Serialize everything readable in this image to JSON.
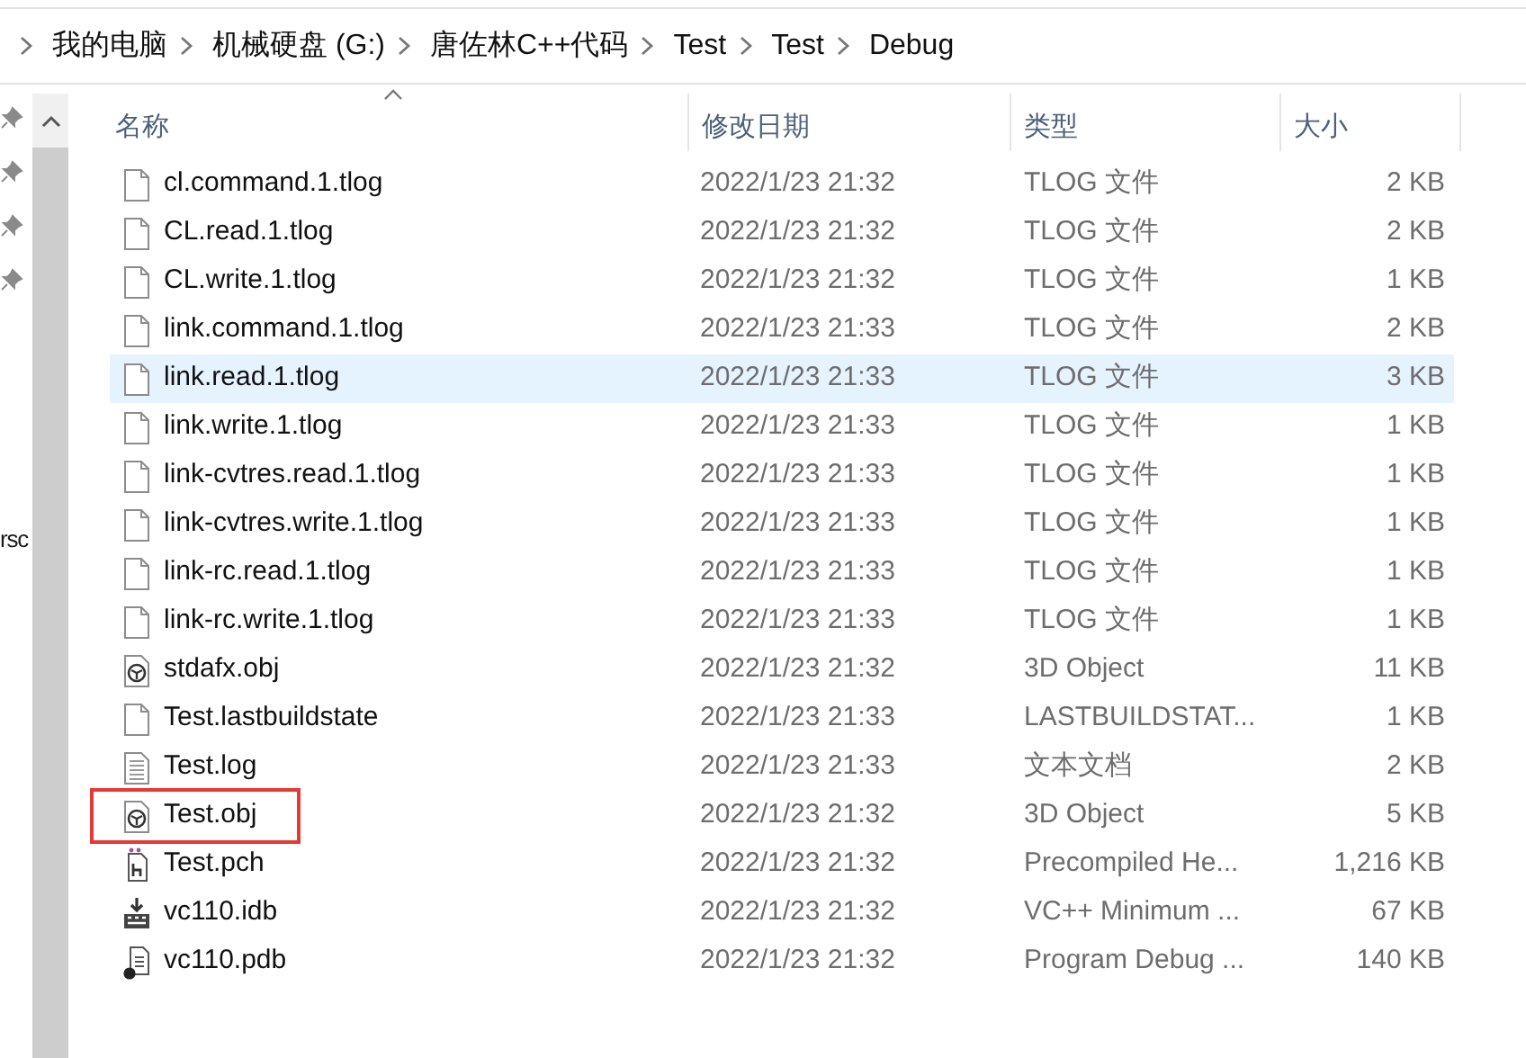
{
  "breadcrumb": [
    "我的电脑",
    "机械硬盘 (G:)",
    "唐佐林C++代码",
    "Test",
    "Test",
    "Debug"
  ],
  "sidebar": {
    "partial_label": "rsc"
  },
  "columns": [
    {
      "label": "名称",
      "sorted": true
    },
    {
      "label": "修改日期",
      "sorted": false
    },
    {
      "label": "类型",
      "sorted": false
    },
    {
      "label": "大小",
      "sorted": false
    }
  ],
  "rows": [
    {
      "name": "cl.command.1.tlog",
      "date": "2022/1/23 21:32",
      "type": "TLOG 文件",
      "size": "2 KB",
      "kind": "blank",
      "hovered": false,
      "highlighted": false
    },
    {
      "name": "CL.read.1.tlog",
      "date": "2022/1/23 21:32",
      "type": "TLOG 文件",
      "size": "2 KB",
      "kind": "blank",
      "hovered": false,
      "highlighted": false
    },
    {
      "name": "CL.write.1.tlog",
      "date": "2022/1/23 21:32",
      "type": "TLOG 文件",
      "size": "1 KB",
      "kind": "blank",
      "hovered": false,
      "highlighted": false
    },
    {
      "name": "link.command.1.tlog",
      "date": "2022/1/23 21:33",
      "type": "TLOG 文件",
      "size": "2 KB",
      "kind": "blank",
      "hovered": false,
      "highlighted": false
    },
    {
      "name": "link.read.1.tlog",
      "date": "2022/1/23 21:33",
      "type": "TLOG 文件",
      "size": "3 KB",
      "kind": "blank",
      "hovered": true,
      "highlighted": false
    },
    {
      "name": "link.write.1.tlog",
      "date": "2022/1/23 21:33",
      "type": "TLOG 文件",
      "size": "1 KB",
      "kind": "blank",
      "hovered": false,
      "highlighted": false
    },
    {
      "name": "link-cvtres.read.1.tlog",
      "date": "2022/1/23 21:33",
      "type": "TLOG 文件",
      "size": "1 KB",
      "kind": "blank",
      "hovered": false,
      "highlighted": false
    },
    {
      "name": "link-cvtres.write.1.tlog",
      "date": "2022/1/23 21:33",
      "type": "TLOG 文件",
      "size": "1 KB",
      "kind": "blank",
      "hovered": false,
      "highlighted": false
    },
    {
      "name": "link-rc.read.1.tlog",
      "date": "2022/1/23 21:33",
      "type": "TLOG 文件",
      "size": "1 KB",
      "kind": "blank",
      "hovered": false,
      "highlighted": false
    },
    {
      "name": "link-rc.write.1.tlog",
      "date": "2022/1/23 21:33",
      "type": "TLOG 文件",
      "size": "1 KB",
      "kind": "blank",
      "hovered": false,
      "highlighted": false
    },
    {
      "name": "stdafx.obj",
      "date": "2022/1/23 21:32",
      "type": "3D Object",
      "size": "11 KB",
      "kind": "object3d",
      "hovered": false,
      "highlighted": false
    },
    {
      "name": "Test.lastbuildstate",
      "date": "2022/1/23 21:33",
      "type": "LASTBUILDSTAT...",
      "size": "1 KB",
      "kind": "blank",
      "hovered": false,
      "highlighted": false
    },
    {
      "name": "Test.log",
      "date": "2022/1/23 21:33",
      "type": "文本文档",
      "size": "2 KB",
      "kind": "text",
      "hovered": false,
      "highlighted": false
    },
    {
      "name": "Test.obj",
      "date": "2022/1/23 21:32",
      "type": "3D Object",
      "size": "5 KB",
      "kind": "object3d",
      "hovered": false,
      "highlighted": true
    },
    {
      "name": "Test.pch",
      "date": "2022/1/23 21:32",
      "type": "Precompiled He...",
      "size": "1,216 KB",
      "kind": "header",
      "hovered": false,
      "highlighted": false
    },
    {
      "name": "vc110.idb",
      "date": "2022/1/23 21:32",
      "type": "VC++ Minimum ...",
      "size": "67 KB",
      "kind": "database",
      "hovered": false,
      "highlighted": false
    },
    {
      "name": "vc110.pdb",
      "date": "2022/1/23 21:32",
      "type": "Program Debug ...",
      "size": "140 KB",
      "kind": "debug",
      "hovered": false,
      "highlighted": false
    }
  ]
}
